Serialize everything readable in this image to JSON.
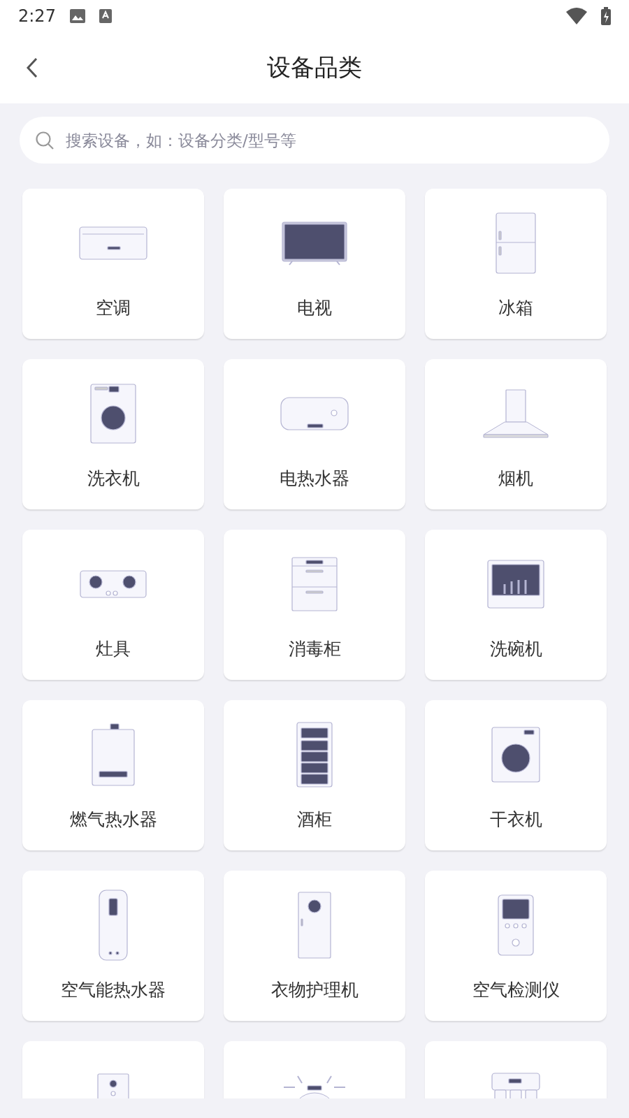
{
  "status_bar": {
    "time": "2:27"
  },
  "header": {
    "title": "设备品类"
  },
  "search": {
    "placeholder": "搜索设备，如：设备分类/型号等"
  },
  "categories": [
    {
      "kind": "full",
      "label": "空调"
    },
    {
      "kind": "full",
      "label": "电视"
    },
    {
      "kind": "full",
      "label": "冰箱"
    },
    {
      "kind": "full",
      "label": "洗衣机"
    },
    {
      "kind": "full",
      "label": "电热水器"
    },
    {
      "kind": "full",
      "label": "烟机"
    },
    {
      "kind": "full",
      "label": "灶具"
    },
    {
      "kind": "full",
      "label": "消毒柜"
    },
    {
      "kind": "full",
      "label": "洗碗机"
    },
    {
      "kind": "full",
      "label": "燃气热水器"
    },
    {
      "kind": "full",
      "label": "酒柜"
    },
    {
      "kind": "full",
      "label": "干衣机"
    },
    {
      "kind": "full",
      "label": "空气能热水器"
    },
    {
      "kind": "full",
      "label": "衣物护理机"
    },
    {
      "kind": "full",
      "label": "空气检测仪"
    },
    {
      "kind": "partial"
    },
    {
      "kind": "partial"
    },
    {
      "kind": "partial"
    }
  ]
}
